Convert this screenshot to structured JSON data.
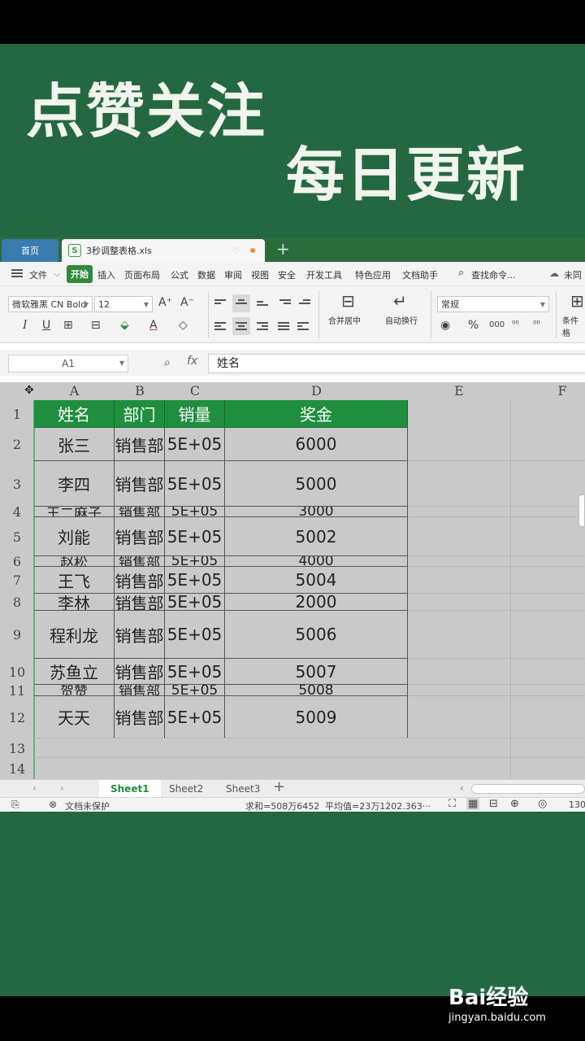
{
  "promo": {
    "line1": "点赞关注",
    "line2": "每日更新"
  },
  "tabs": {
    "home": "首页",
    "doc_icon": "S",
    "doc": "3秒调整表格.xls",
    "cloud": "♡",
    "plus": "+"
  },
  "menu": {
    "file": "文件",
    "items": [
      "开始",
      "插入",
      "页面布局",
      "公式",
      "数据",
      "审阅",
      "视图",
      "安全",
      "开发工具",
      "特色应用",
      "文档助手"
    ],
    "search": "查找命令...",
    "cloud": "未同"
  },
  "ribbon": {
    "font_name": "微软雅黑 CN Bold",
    "font_size": "12",
    "grow": "A⁺",
    "shrink": "A⁻",
    "italic": "I",
    "underline": "U",
    "merge": "合并居中",
    "wrap": "自动换行",
    "number_format": "常规",
    "percent": "%",
    "thousands": "000",
    "conditional": "条件格"
  },
  "formula": {
    "cell_ref": "A1",
    "fx": "fx",
    "content": "姓名"
  },
  "columns": [
    "A",
    "B",
    "C",
    "D",
    "E",
    "F"
  ],
  "table": {
    "headers": [
      "姓名",
      "部门",
      "销量",
      "奖金"
    ],
    "rows": [
      {
        "num": "2",
        "name": "张三",
        "dept": "销售部",
        "sales": "5E+05",
        "bonus": "6000"
      },
      {
        "num": "3",
        "name": "李四",
        "dept": "销售部",
        "sales": "5E+05",
        "bonus": "5000"
      },
      {
        "num": "4",
        "name": "王二麻子",
        "dept": "销售部",
        "sales": "5E+05",
        "bonus": "3000"
      },
      {
        "num": "5",
        "name": "刘能",
        "dept": "销售部",
        "sales": "5E+05",
        "bonus": "5002"
      },
      {
        "num": "6",
        "name": "赵松",
        "dept": "销售部",
        "sales": "5E+05",
        "bonus": "4000"
      },
      {
        "num": "7",
        "name": "王飞",
        "dept": "销售部",
        "sales": "5E+05",
        "bonus": "5004"
      },
      {
        "num": "8",
        "name": "李林",
        "dept": "销售部",
        "sales": "5E+05",
        "bonus": "2000"
      },
      {
        "num": "9",
        "name": "程利龙",
        "dept": "销售部",
        "sales": "5E+05",
        "bonus": "5006"
      },
      {
        "num": "10",
        "name": "苏鱼立",
        "dept": "销售部",
        "sales": "5E+05",
        "bonus": "5007"
      },
      {
        "num": "11",
        "name": "贺赞",
        "dept": "销售部",
        "sales": "5E+05",
        "bonus": "5008"
      },
      {
        "num": "12",
        "name": "天天",
        "dept": "销售部",
        "sales": "5E+05",
        "bonus": "5009"
      }
    ],
    "row1": "1",
    "row13": "13",
    "row14": "14"
  },
  "sheets": [
    "Sheet1",
    "Sheet2",
    "Sheet3"
  ],
  "status": {
    "protect": "文档未保护",
    "sum": "求和=508万6452",
    "avg": "平均值=23万1202.363···",
    "zoom": "130"
  },
  "watermark": {
    "logo": "Bai经验",
    "url": "jingyan.baidu.com"
  },
  "colors": {
    "brand_green": "#246841",
    "header_green": "#1f8f3f",
    "home_tab": "#3a7bb0"
  }
}
